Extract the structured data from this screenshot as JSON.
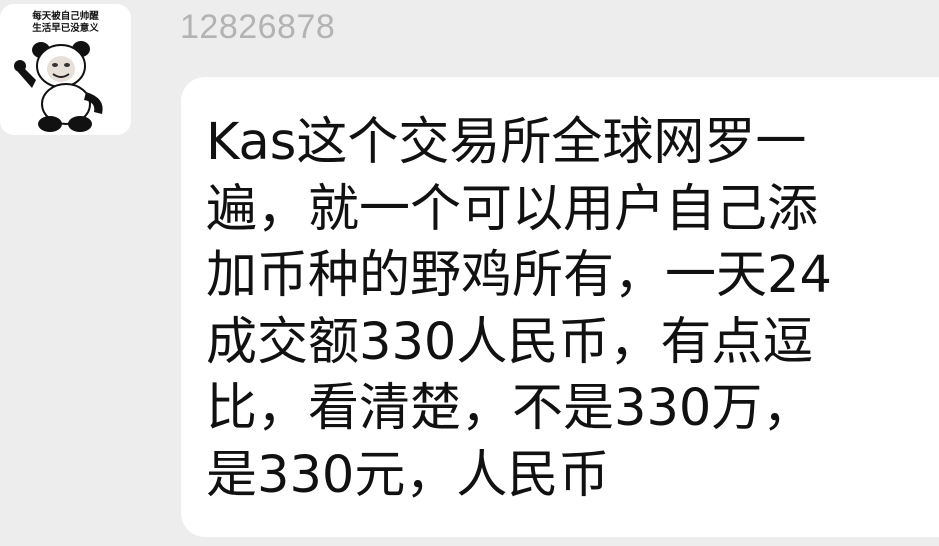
{
  "avatar": {
    "caption_lines": [
      "每天被自己帅醒",
      "生活早已没意义"
    ],
    "icon": "panda-meme-icon"
  },
  "message": {
    "sender_id": "12826878",
    "lines": [
      "Kas这个交易所全球网罗一",
      "遍，就一个可以用户自己添",
      "加币种的野鸡所有，一天24",
      "成交额330人民币，有点逗",
      "比，看清楚，不是330万，",
      "是330元，人民币"
    ]
  },
  "colors": {
    "background": "#ededed",
    "bubble": "#ffffff",
    "sender_id": "#b3b3b3",
    "text": "#111111"
  }
}
